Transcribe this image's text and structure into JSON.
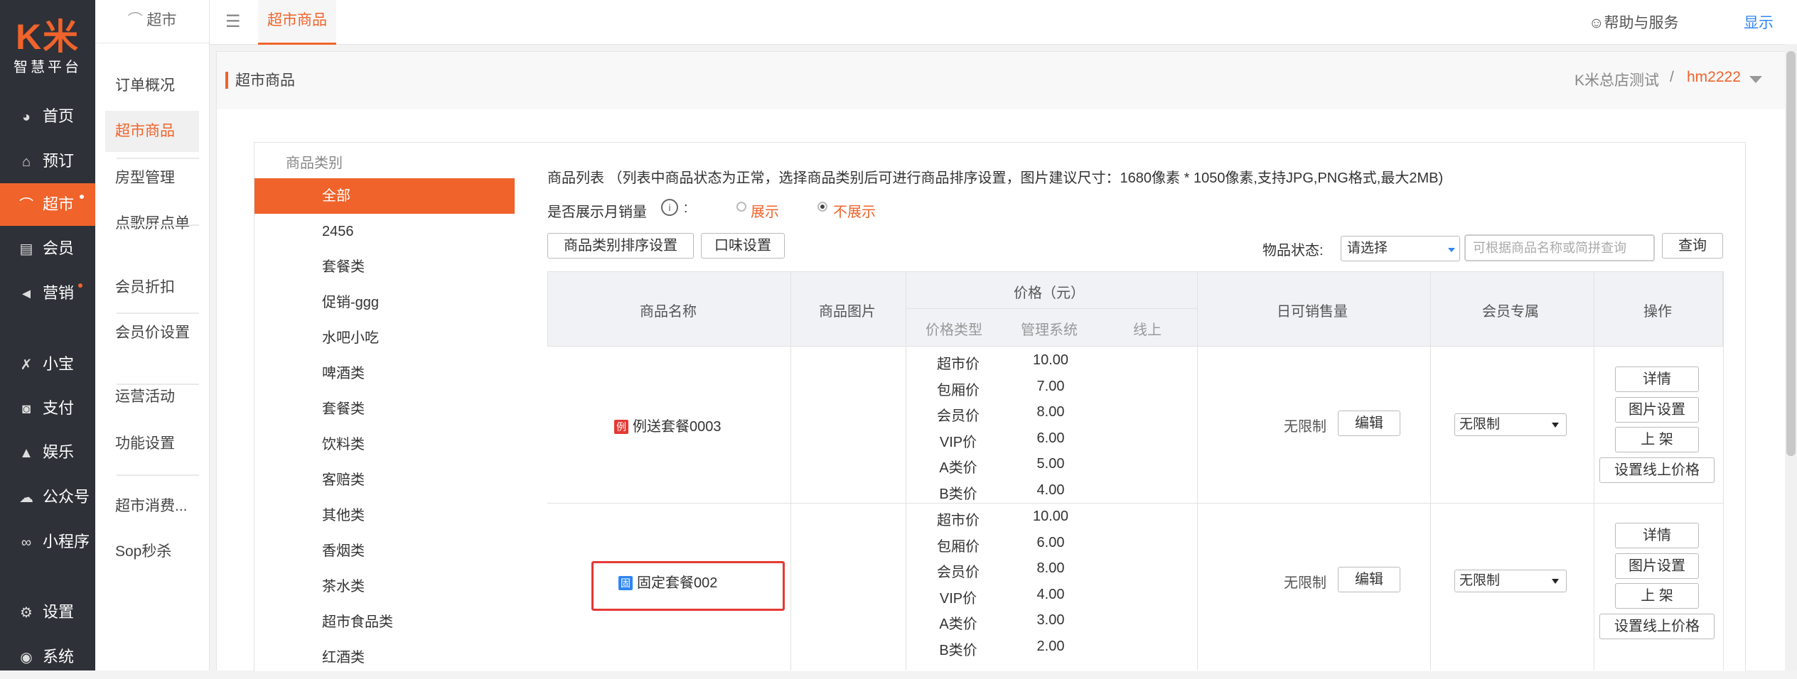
{
  "logo": {
    "mark": "K米",
    "sub": "智慧平台"
  },
  "nav": [
    {
      "label": "首页",
      "icon": "dashboard-icon",
      "glyph": "◕"
    },
    {
      "label": "预订",
      "icon": "reserve-icon",
      "glyph": "⌂"
    },
    {
      "label": "超市",
      "icon": "market-icon",
      "glyph": "⌒"
    },
    {
      "label": "会员",
      "icon": "card-icon",
      "glyph": "▤"
    },
    {
      "label": "营销",
      "icon": "megaphone-icon",
      "glyph": "◄"
    },
    {
      "label": "小宝",
      "icon": "robot-icon",
      "glyph": "✗"
    },
    {
      "label": "支付",
      "icon": "payment-icon",
      "glyph": "◙"
    },
    {
      "label": "娱乐",
      "icon": "lock-icon",
      "glyph": "▲"
    },
    {
      "label": "公众号",
      "icon": "wechat-icon",
      "glyph": "☁"
    },
    {
      "label": "小程序",
      "icon": "miniapp-icon",
      "glyph": "∞"
    },
    {
      "label": "设置",
      "icon": "gear-icon",
      "glyph": "⚙"
    },
    {
      "label": "系统",
      "icon": "system-icon",
      "glyph": "◉"
    }
  ],
  "sub_menu": {
    "head": "超市",
    "items": [
      "订单概况",
      "超市商品",
      "房型管理",
      "点歌屏点单",
      "会员折扣",
      "会员价设置",
      "运营活动",
      "功能设置",
      "超市消费...",
      "Sop秒杀"
    ]
  },
  "topbar": {
    "menu_glyph": "☰",
    "tab": "超市商品",
    "help": "☺帮助与服务",
    "show": "显示"
  },
  "page_header": {
    "title": "超市商品",
    "crumb_store": "K米总店测试",
    "crumb_sep": "/",
    "crumb_user": "hm2222"
  },
  "categories": {
    "head": "商品类别",
    "items": [
      "全部",
      "2456",
      "套餐类",
      "促销-ggg",
      "水吧小吃",
      "啤酒类",
      "套餐类",
      "饮料类",
      "客赔类",
      "其他类",
      "香烟类",
      "茶水类",
      "超市食品类",
      "红酒类"
    ]
  },
  "goods": {
    "desc": "商品列表 （列表中商品状态为正常，选择商品类别后可进行商品排序设置，图片建议尺寸：1680像素 * 1050像素,支持JPG,PNG格式,最大2MB)",
    "month_label": "是否展示月销量",
    "info": "i",
    "colon": ":",
    "opt_show": "展示",
    "opt_hide": "不展示",
    "btn_sort": "商品类别排序设置",
    "btn_taste": "口味设置",
    "state_label": "物品状态:",
    "state_value": "请选择",
    "search_placeholder": "可根据商品名称或简拼查询",
    "btn_query": "查询"
  },
  "table": {
    "headers": {
      "name": "商品名称",
      "image": "商品图片",
      "price": "价格（元）",
      "ptype": "价格类型",
      "pmanage": "管理系统",
      "ponline": "线上",
      "daily": "日可销售量",
      "member": "会员专属",
      "ops": "操作"
    },
    "rows": [
      {
        "badge": "例",
        "name": "例送套餐0003",
        "prices": [
          {
            "type": "超市价",
            "value": "10.00"
          },
          {
            "type": "包厢价",
            "value": "7.00"
          },
          {
            "type": "会员价",
            "value": "8.00"
          },
          {
            "type": "VIP价",
            "value": "6.00"
          },
          {
            "type": "A类价",
            "value": "5.00"
          },
          {
            "type": "B类价",
            "value": "4.00"
          }
        ],
        "daily": "无限制",
        "edit": "编辑",
        "member": "无限制",
        "ops": [
          "详情",
          "图片设置",
          "上 架",
          "设置线上价格"
        ]
      },
      {
        "badge": "固",
        "name": "固定套餐002",
        "prices": [
          {
            "type": "超市价",
            "value": "10.00"
          },
          {
            "type": "包厢价",
            "value": "6.00"
          },
          {
            "type": "会员价",
            "value": "8.00"
          },
          {
            "type": "VIP价",
            "value": "4.00"
          },
          {
            "type": "A类价",
            "value": "3.00"
          },
          {
            "type": "B类价",
            "value": "2.00"
          }
        ],
        "daily": "无限制",
        "edit": "编辑",
        "member": "无限制",
        "ops": [
          "详情",
          "图片设置",
          "上 架",
          "设置线上价格"
        ]
      }
    ]
  }
}
